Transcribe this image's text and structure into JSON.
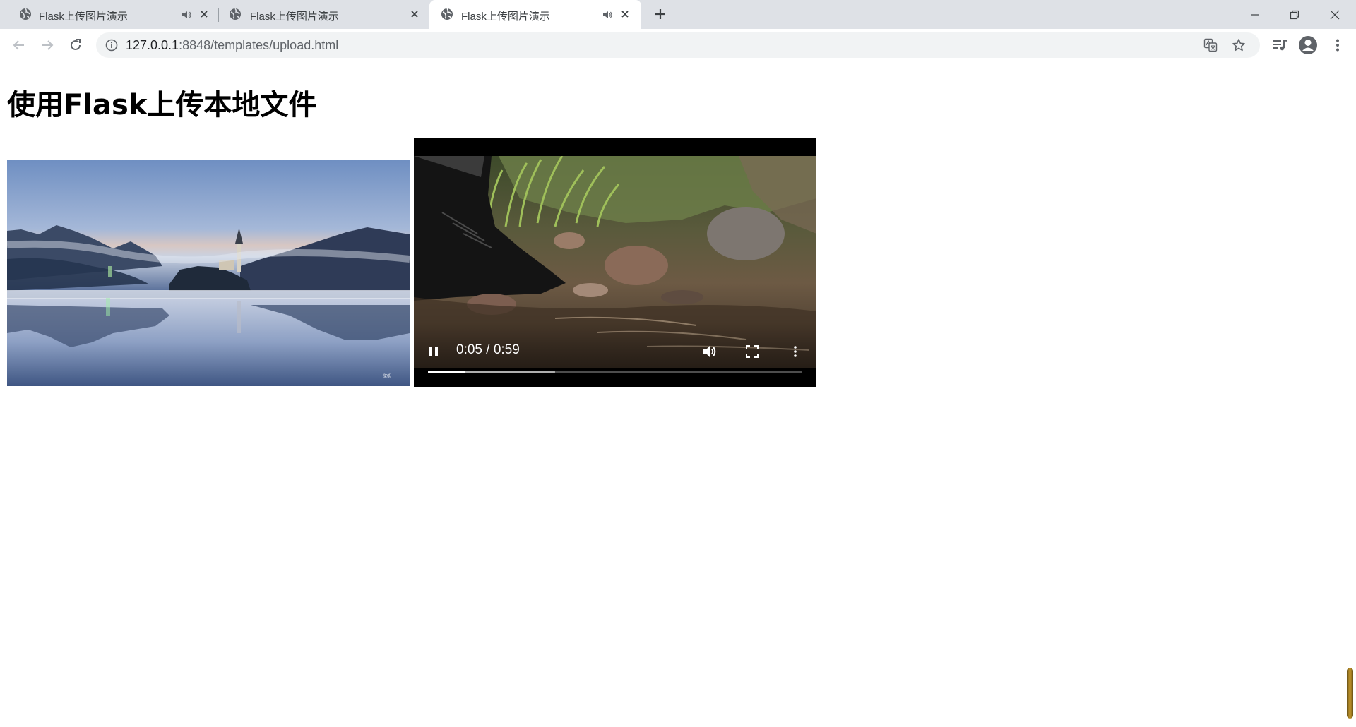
{
  "browser": {
    "tabs": [
      {
        "title": "Flask上传图片演示",
        "audio": true,
        "active": false
      },
      {
        "title": "Flask上传图片演示",
        "audio": false,
        "active": false
      },
      {
        "title": "Flask上传图片演示",
        "audio": true,
        "active": true
      }
    ],
    "url_host": "127.0.0.1",
    "url_path": ":8848/templates/upload.html"
  },
  "page": {
    "title": "使用Flask上传本地文件"
  },
  "video": {
    "time_display": "0:05 / 0:59",
    "played_fraction": 0.1,
    "buffered_fraction": 0.34
  },
  "icons": [
    "globe-icon",
    "speaker-icon",
    "close-icon",
    "plus-icon",
    "back-arrow-icon",
    "forward-arrow-icon",
    "reload-icon",
    "info-icon",
    "translate-icon",
    "star-icon",
    "media-control-icon",
    "account-icon",
    "kebab-menu-icon",
    "pause-icon",
    "volume-icon",
    "fullscreen-icon"
  ]
}
